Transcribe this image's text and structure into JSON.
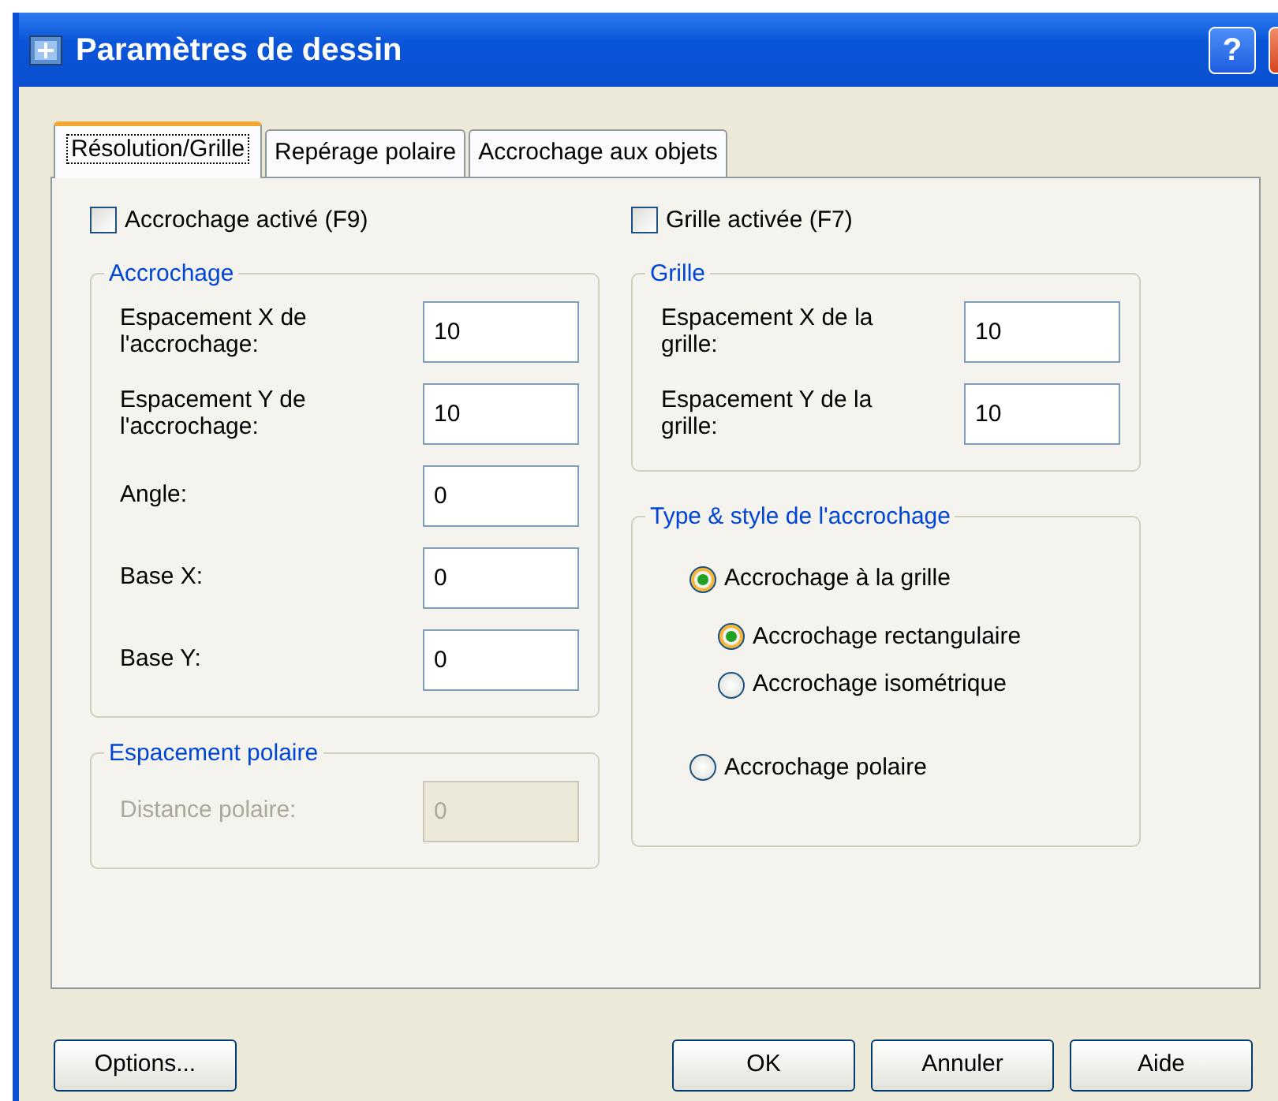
{
  "window": {
    "title": "Paramètres de dessin",
    "help_button": "?"
  },
  "tabs": [
    {
      "label": "Résolution/Grille",
      "selected": true
    },
    {
      "label": "Repérage polaire",
      "selected": false
    },
    {
      "label": "Accrochage aux objets",
      "selected": false
    }
  ],
  "snap_on": {
    "label": "Accrochage activé (F9)",
    "checked": false
  },
  "snap_group": {
    "title": "Accrochage",
    "fields": [
      {
        "label": "Espacement X de l'accrochage:",
        "value": "10"
      },
      {
        "label": "Espacement Y de l'accrochage:",
        "value": "10"
      },
      {
        "label": "Angle:",
        "value": "0"
      },
      {
        "label": "Base X:",
        "value": "0"
      },
      {
        "label": "Base Y:",
        "value": "0"
      }
    ]
  },
  "polar_group": {
    "title": "Espacement polaire",
    "fields": [
      {
        "label": "Distance polaire:",
        "value": "0",
        "disabled": true
      }
    ]
  },
  "grid_on": {
    "label": "Grille activée (F7)",
    "checked": false
  },
  "grid_group": {
    "title": "Grille",
    "fields": [
      {
        "label": "Espacement X de la grille:",
        "value": "10"
      },
      {
        "label": "Espacement Y de la grille:",
        "value": "10"
      }
    ]
  },
  "snap_type_group": {
    "title": "Type & style de l'accrochage",
    "options": [
      {
        "label": "Accrochage à la grille",
        "selected": true,
        "children": [
          {
            "label": "Accrochage rectangulaire",
            "selected": true
          },
          {
            "label": "Accrochage isométrique",
            "selected": false
          }
        ]
      },
      {
        "label": "Accrochage polaire",
        "selected": false
      }
    ]
  },
  "buttons": [
    {
      "label": "Options...",
      "kind": "left"
    },
    {
      "label": "OK",
      "kind": "right"
    },
    {
      "label": "Annuler",
      "kind": "right"
    },
    {
      "label": "Aide",
      "kind": "right"
    }
  ]
}
